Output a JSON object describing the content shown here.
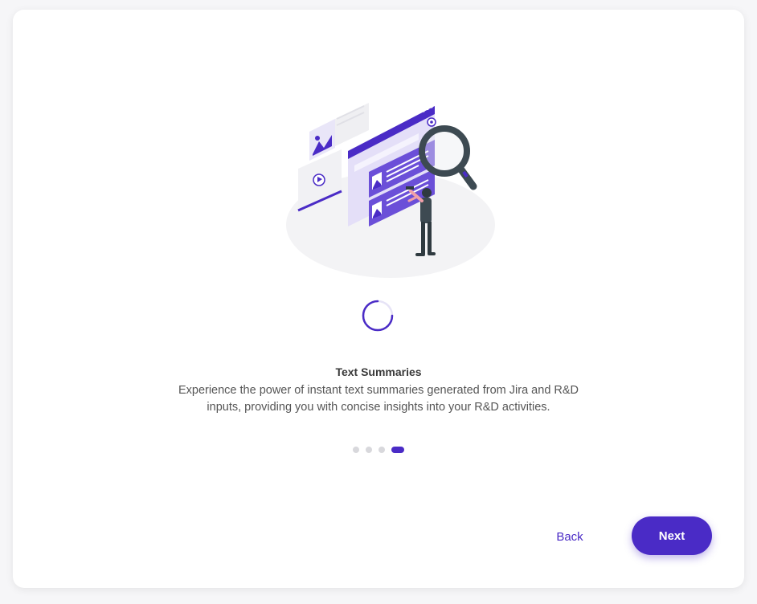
{
  "onboarding": {
    "title": "Text Summaries",
    "description": "Experience the power of instant text summaries generated from Jira and R&D inputs, providing you with concise insights into your R&D activities.",
    "progress": {
      "total_steps": 4,
      "current_step": 4
    },
    "back_label": "Back",
    "next_label": "Next"
  },
  "colors": {
    "accent": "#4a2bc6",
    "inactive_dot": "#d8d8dc",
    "text": "#3a3a3a"
  },
  "icons": {
    "illustration": "search-documents-illustration",
    "loader": "loading-spinner-icon"
  }
}
